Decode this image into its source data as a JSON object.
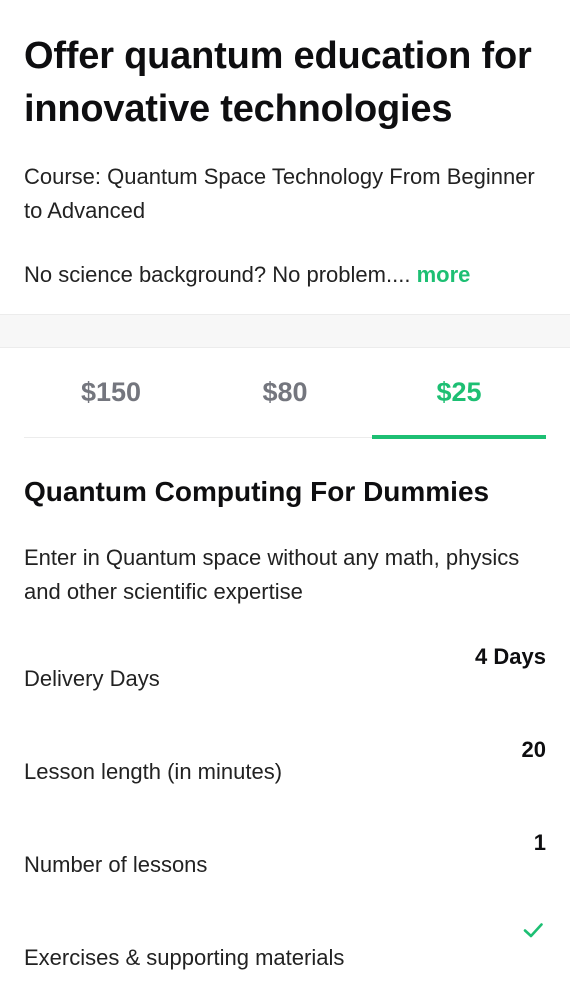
{
  "gig": {
    "title": "Offer quantum education for innovative technologies",
    "course_line": "Course: Quantum Space Technology From Beginner to Advanced",
    "description": "No science background? No problem....",
    "more_label": "more"
  },
  "tabs": [
    {
      "label": "$150",
      "active": false
    },
    {
      "label": "$80",
      "active": false
    },
    {
      "label": "$25",
      "active": true
    }
  ],
  "package": {
    "title": "Quantum Computing For Dummies",
    "description": "Enter in Quantum space without any math, physics and other scientific expertise",
    "specs": [
      {
        "label": "Delivery Days",
        "value": "4 Days"
      },
      {
        "label": "Lesson length (in minutes)",
        "value": "20"
      },
      {
        "label": "Number of lessons",
        "value": "1"
      },
      {
        "label": "Exercises & supporting materials",
        "value": null,
        "included": true,
        "icon": "checkmark-icon"
      }
    ]
  },
  "colors": {
    "accent": "#1dbf73",
    "tab_inactive": "#74767e",
    "divider": "#ececec"
  }
}
